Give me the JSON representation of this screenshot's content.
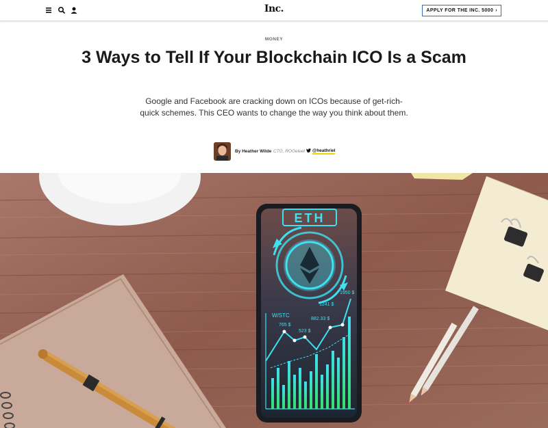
{
  "header": {
    "logo": "Inc.",
    "cta_label": "APPLY FOR THE INC. 5000",
    "cta_chevron": "›",
    "icons": [
      "menu-icon",
      "search-icon",
      "user-icon"
    ]
  },
  "article": {
    "category": "MONEY",
    "title": "3 Ways to Tell If Your Blockchain ICO Is a Scam",
    "dek": "Google and Facebook are cracking down on ICOs because of get-rich-quick schemes. This CEO wants to change the way you think about them.",
    "byline": {
      "author_prefix": "By Heather Wilde",
      "role": "CTO, ROOeleet",
      "twitter_handle": "@heathriel",
      "twitter_icon": "twitter-bird-icon"
    }
  },
  "hero_image": {
    "screen_label": "ETH",
    "chart_label": "W/STC",
    "values": [
      "1950 $",
      "1241 $",
      "882.33 $",
      "765 $",
      "523 $"
    ]
  },
  "colors": {
    "cta_border": "#2c6fbf",
    "handle_underline": "#f2d400",
    "eth_cyan": "#3fe0f0",
    "bar_green": "#35e06a"
  }
}
